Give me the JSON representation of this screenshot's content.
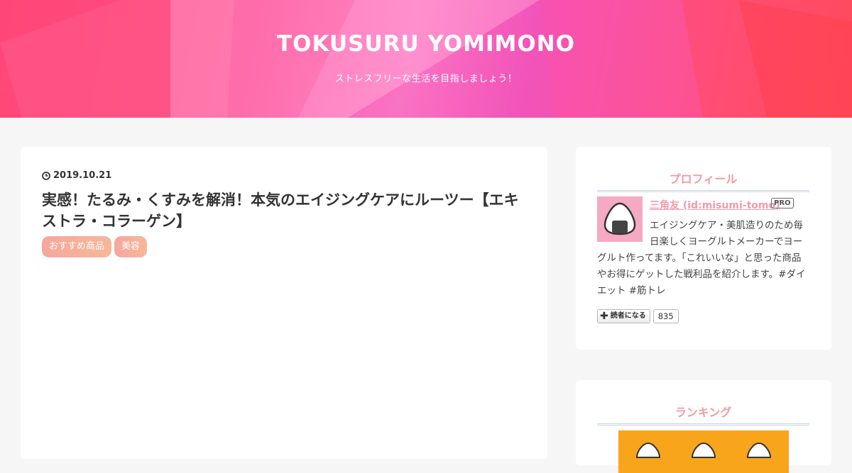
{
  "header": {
    "title": "TOKUSURU YOMIMONO",
    "description": "ストレスフリーな生活を目指しましょう！",
    "colors": {
      "left": "#ff4f86",
      "center": "#ff7fc4",
      "right": "#ff4a52"
    }
  },
  "entry": {
    "date": "2019.10.21",
    "title": "実感！たるみ・くすみを解消！本気のエイジングケアにルーツー【エキストラ・コラーゲン】",
    "categories": [
      "おすすめ商品",
      "美容"
    ]
  },
  "sidebar": {
    "profile": {
      "heading": "プロフィール",
      "name": "三角友 (id:misumi-tomo)",
      "badge": "PRO",
      "description": "エイジングケア・美肌造りのため毎日楽しくヨーグルトメーカーでヨーグルト作ってます。「これいいな」と思った商品やお得にゲットした戦利品を紹介します。#ダイエット #筋トレ",
      "subscribe_label": "読者になる",
      "subscriber_count": "835",
      "avatar_icon": "onigiri-icon"
    },
    "ranking": {
      "heading": "ランキング"
    }
  },
  "colors": {
    "accent_pink": "#f39aa5",
    "category_bg": "#f7a79c",
    "banner_orange": "#f8a51c"
  }
}
